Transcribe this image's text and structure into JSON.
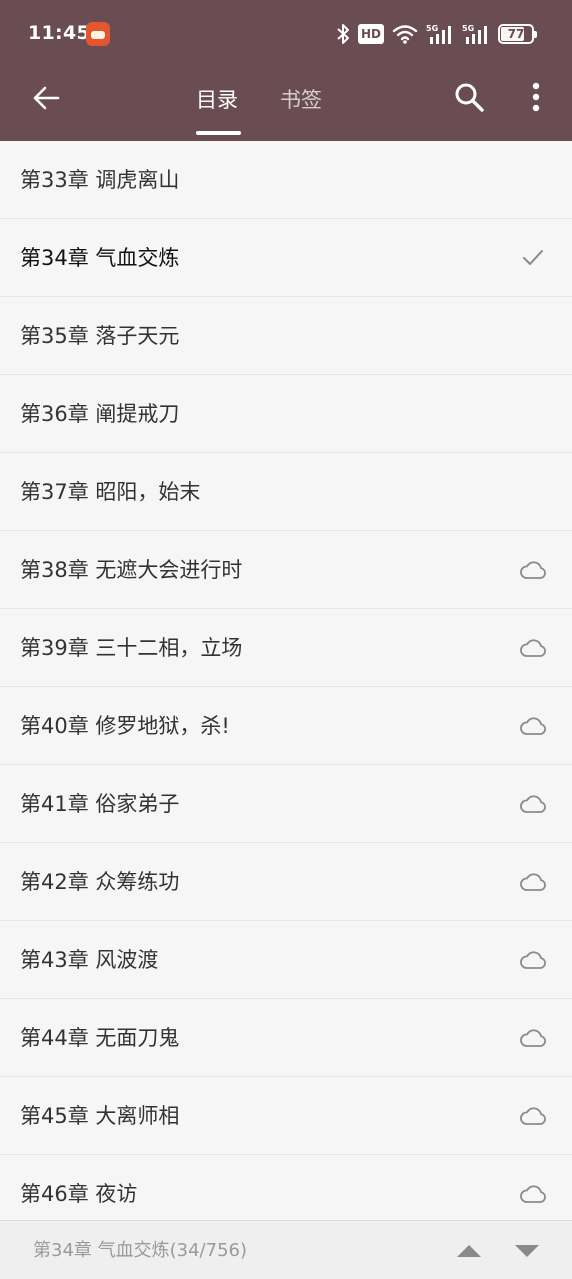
{
  "status_bar": {
    "time": "11:45",
    "hd_label": "HD",
    "battery": "77",
    "battery_level": 0.77,
    "icons": [
      "bluetooth-icon",
      "hd-icon",
      "wifi-icon",
      "5g-signal-icon",
      "5g-signal-icon",
      "battery-icon"
    ]
  },
  "toolbar": {
    "back_icon": "arrow-left-icon",
    "tabs": [
      {
        "label": "目录",
        "selected": true
      },
      {
        "label": "书签",
        "selected": false
      }
    ],
    "search_icon": "search-icon",
    "more_icon": "more-vert-icon"
  },
  "chapters": [
    {
      "label": "第33章 调虎离山",
      "icon": "none"
    },
    {
      "label": "第34章 气血交炼",
      "icon": "check-icon"
    },
    {
      "label": "第35章 落子天元",
      "icon": "none"
    },
    {
      "label": "第36章 阐提戒刀",
      "icon": "none"
    },
    {
      "label": "第37章 昭阳，始末",
      "icon": "none"
    },
    {
      "label": "第38章 无遮大会进行时",
      "icon": "cloud-icon"
    },
    {
      "label": "第39章 三十二相，立场",
      "icon": "cloud-icon"
    },
    {
      "label": "第40章 修罗地狱，杀!",
      "icon": "cloud-icon"
    },
    {
      "label": "第41章 俗家弟子",
      "icon": "cloud-icon"
    },
    {
      "label": "第42章 众筹练功",
      "icon": "cloud-icon"
    },
    {
      "label": "第43章 风波渡",
      "icon": "cloud-icon"
    },
    {
      "label": "第44章 无面刀鬼",
      "icon": "cloud-icon"
    },
    {
      "label": "第45章 大离师相",
      "icon": "cloud-icon"
    },
    {
      "label": "第46章 夜访",
      "icon": "cloud-icon"
    }
  ],
  "bottom_bar": {
    "current": "第34章 气血交炼(34/756)",
    "up_icon": "triangle-up-icon",
    "down_icon": "triangle-down-icon"
  },
  "colors": {
    "header": "#6a4d52",
    "background": "#f6f6f6",
    "divider": "#e7e7e7",
    "icon_gray": "#8a8a8a"
  }
}
